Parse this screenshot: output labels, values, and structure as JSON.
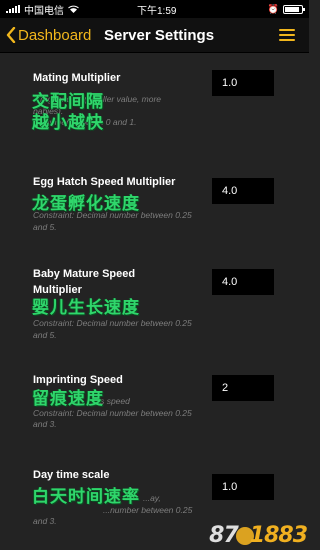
{
  "status_bar": {
    "carrier": "中国电信",
    "time": "下午1:59",
    "battery_level": 0.85
  },
  "nav": {
    "back_label": "Dashboard",
    "title": "Server Settings",
    "back_icon": "chevron-left-icon",
    "menu_icon": "hamburger-menu-icon"
  },
  "settings": [
    {
      "label": "Mating Multiplier",
      "value": "1.0",
      "description_partial": "...regnancies (smaller value, more babies).",
      "constraint_partial": "...number between 0 and 1.",
      "overlay_line1": "交配间隔",
      "overlay_line2": "越小越快"
    },
    {
      "label": "Egg Hatch Speed Multiplier",
      "value": "4.0",
      "constraint": "Constraint: Decimal number between 0.25 and 5.",
      "overlay_line1": "龙蛋孵化速度"
    },
    {
      "label": "Baby Mature Speed Multiplier",
      "value": "4.0",
      "constraint": "Constraint: Decimal number between 0.25 and 5.",
      "overlay_line1": "婴儿生长速度"
    },
    {
      "label": "Imprinting Speed",
      "value": "2",
      "description_partial": "...s speed",
      "constraint": "Constraint: Decimal number between 0.25 and 3.",
      "overlay_line1": "留痕速度"
    },
    {
      "label": "Day time scale",
      "value": "1.0",
      "description_partial": "...ay,",
      "constraint_partial": "...number between 0.25 and 3.",
      "overlay_line1": "白天时间速率"
    }
  ],
  "watermark": {
    "part1": "87",
    "part2": "1883"
  },
  "colors": {
    "accent": "#f2b71d",
    "background": "#232323",
    "overlay_text": "#2fd66b"
  }
}
